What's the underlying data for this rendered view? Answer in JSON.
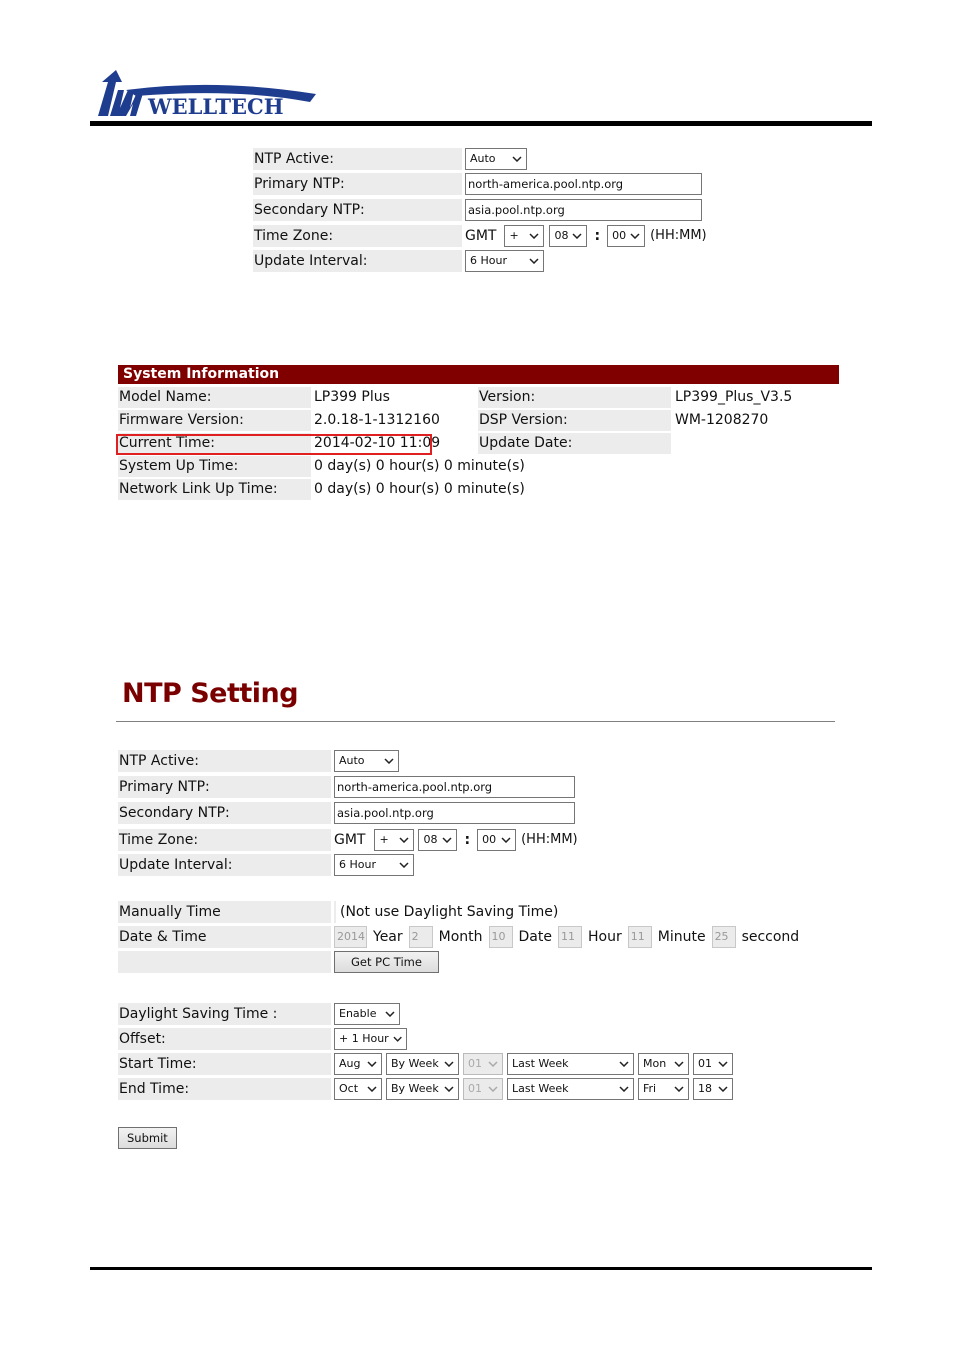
{
  "brand": {
    "logo_text": "WELLTECH",
    "accent_color": "#800000"
  },
  "top_ntp_form": {
    "ntp_active": {
      "label": "NTP Active:",
      "value": "Auto"
    },
    "primary_ntp": {
      "label": "Primary NTP:",
      "value": "north-america.pool.ntp.org"
    },
    "secondary_ntp": {
      "label": "Secondary NTP:",
      "value": "asia.pool.ntp.org"
    },
    "time_zone": {
      "label": "Time Zone:",
      "prefix": "GMT",
      "sign": "+",
      "hours": "08",
      "separator": ":",
      "minutes": "00",
      "suffix": "(HH:MM)"
    },
    "update_interval": {
      "label": "Update Interval:",
      "value": "6 Hour"
    }
  },
  "system_information": {
    "title": "System Information",
    "model_name": {
      "label": "Model Name:",
      "value": "LP399 Plus"
    },
    "version": {
      "label": "Version:",
      "value": "LP399_Plus_V3.5"
    },
    "firmware_version": {
      "label": "Firmware Version:",
      "value": "2.0.18-1-1312160"
    },
    "dsp_version": {
      "label": "DSP Version:",
      "value": "WM-1208270"
    },
    "current_time": {
      "label": "Current Time:",
      "value": "2014-02-10 11:09"
    },
    "update_date": {
      "label": "Update Date:",
      "value": ""
    },
    "system_up_time": {
      "label": "System Up Time:",
      "value": "0 day(s) 0 hour(s) 0 minute(s)"
    },
    "network_link_up_time": {
      "label": "Network Link Up Time:",
      "value": "0 day(s) 0 hour(s) 0 minute(s)"
    }
  },
  "ntp_setting": {
    "title": "NTP Setting",
    "ntp_active": {
      "label": "NTP Active:",
      "value": "Auto"
    },
    "primary_ntp": {
      "label": "Primary NTP:",
      "value": "north-america.pool.ntp.org"
    },
    "secondary_ntp": {
      "label": "Secondary NTP:",
      "value": "asia.pool.ntp.org"
    },
    "time_zone": {
      "label": "Time Zone:",
      "prefix": "GMT",
      "sign": "+",
      "hours": "08",
      "separator": ":",
      "minutes": "00",
      "suffix": "(HH:MM)"
    },
    "update_interval": {
      "label": "Update Interval:",
      "value": "6 Hour"
    },
    "manual_time": {
      "label": "Manually Time",
      "note": "(Not use Daylight Saving Time)",
      "date_time_label": "Date & Time",
      "year": {
        "value": "2014",
        "unit": "Year"
      },
      "month": {
        "value": "2",
        "unit": "Month"
      },
      "date": {
        "value": "10",
        "unit": "Date"
      },
      "hour": {
        "value": "11",
        "unit": "Hour"
      },
      "minute": {
        "value": "11",
        "unit": "Minute"
      },
      "second": {
        "value": "25",
        "unit": "seccond"
      },
      "get_pc_time_label": "Get PC Time"
    },
    "dst": {
      "label": "Daylight Saving Time :",
      "value": "Enable",
      "offset": {
        "label": "Offset:",
        "value": "+ 1 Hour"
      },
      "start_time": {
        "label": "Start Time:",
        "month": "Aug",
        "mode": "By Week",
        "day_num": "01",
        "week": "Last Week",
        "weekday": "Mon",
        "hour": "01"
      },
      "end_time": {
        "label": "End Time:",
        "month": "Oct",
        "mode": "By Week",
        "day_num": "01",
        "week": "Last Week",
        "weekday": "Fri",
        "hour": "18"
      }
    },
    "submit_label": "Submit"
  }
}
